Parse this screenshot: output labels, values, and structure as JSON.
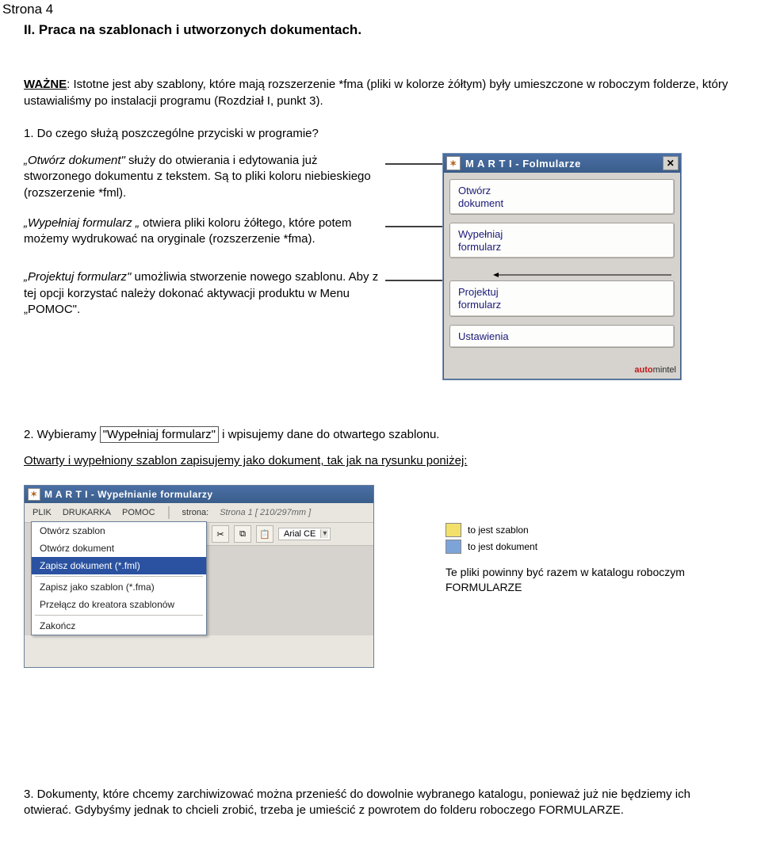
{
  "page_label": "Strona 4",
  "section_title": "II. Praca na szablonach i utworzonych dokumentach.",
  "important_label": "WAŻNE",
  "important_text": ": Istotne jest aby szablony, które mają rozszerzenie  *fma (pliki w kolorze żółtym) były umieszczone w roboczym folderze, który ustawialiśmy po instalacji programu (Rozdział I, punkt 3).",
  "q1": "1. Do czego służą poszczególne przyciski w programie?",
  "desc1a_q": "„Otwórz dokument\"",
  "desc1a_rest": " służy do otwierania i edytowania już stworzonego dokumentu z tekstem. Są to pliki koloru niebieskiego (rozszerzenie *fml).",
  "desc1b_q": "„Wypełniaj formularz „",
  "desc1b_rest": " otwiera pliki koloru żółtego, które potem możemy wydrukować na oryginale (rozszerzenie *fma).",
  "desc1c_q": "„Projektuj formularz\"",
  "desc1c_rest": " umożliwia stworzenie nowego szablonu. Aby z tej opcji korzystać należy dokonać aktywacji produktu w Menu „POMOC\".",
  "marti_title": "M A R T I   -  Folmularze",
  "marti_btn1a": "Otwórz",
  "marti_btn1b": "dokument",
  "marti_btn2a": "Wypełniaj",
  "marti_btn2b": "formularz",
  "marti_btn3a": "Projektuj",
  "marti_btn3b": "formularz",
  "marti_btn4": "Ustawienia",
  "marti_brand_a": "auto",
  "marti_brand_b": "mintel",
  "step2_pre": "2. Wybieramy ",
  "step2_boxed": "\"Wypełniaj formularz\"",
  "step2_post": " i wpisujemy dane do otwartego szablonu.",
  "step2_line2": "Otwarty i wypełniony szablon zapisujemy jako dokument, tak jak na rysunku poniżej:",
  "win_title": "M A R T I  -  Wypełnianie formularzy",
  "menu_plik": "PLIK",
  "menu_druk": "DRUKARKA",
  "menu_pomoc": "POMOC",
  "menu_strona_lbl": "strona:",
  "menu_strona_val": "Strona 1    [ 210/297mm ]",
  "combo_font": "Arial CE",
  "dd1": "Otwórz szablon",
  "dd2": "Otwórz dokument",
  "dd3": "Zapisz dokument (*.fml)",
  "dd4": "Zapisz jako szablon (*.fma)",
  "dd5": "Przełącz do kreatora szablonów",
  "dd6": "Zakończ",
  "legend1": "to jest szablon",
  "legend2": "to jest dokument",
  "legend_note": "Te pliki powinny być razem w katalogu roboczym FORMULARZE",
  "step3": "3. Dokumenty, które chcemy zarchiwizować można przenieść do dowolnie wybranego katalogu, ponieważ już nie będziemy ich otwierać. Gdybyśmy jednak to chcieli zrobić, trzeba je umieścić z powrotem do folderu roboczego FORMULARZE."
}
